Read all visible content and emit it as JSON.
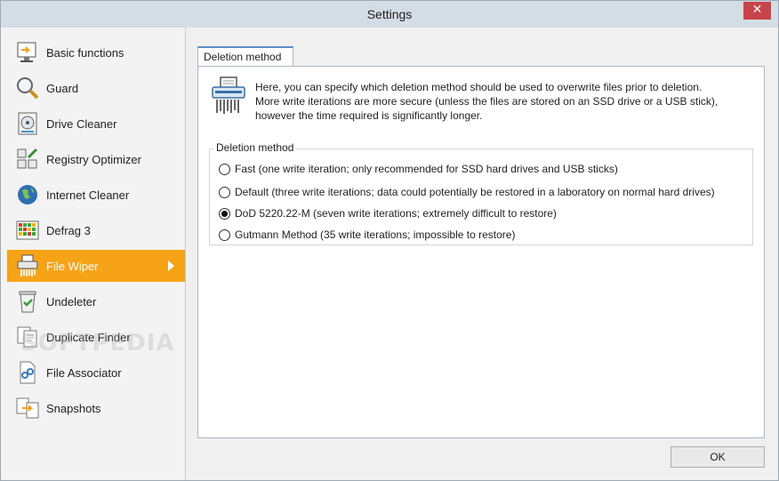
{
  "window": {
    "title": "Settings",
    "close_glyph": "✕"
  },
  "sidebar": {
    "items": [
      {
        "label": "Basic functions",
        "icon": "basic-functions-icon"
      },
      {
        "label": "Guard",
        "icon": "magnifier-icon"
      },
      {
        "label": "Drive Cleaner",
        "icon": "drive-icon"
      },
      {
        "label": "Registry Optimizer",
        "icon": "registry-icon"
      },
      {
        "label": "Internet Cleaner",
        "icon": "globe-icon"
      },
      {
        "label": "Defrag 3",
        "icon": "defrag-icon"
      },
      {
        "label": "File Wiper",
        "icon": "shredder-icon",
        "active": true
      },
      {
        "label": "Undeleter",
        "icon": "recycle-bin-icon"
      },
      {
        "label": "Duplicate Finder",
        "icon": "duplicate-icon"
      },
      {
        "label": "File Associator",
        "icon": "file-link-icon"
      },
      {
        "label": "Snapshots",
        "icon": "snapshot-icon"
      }
    ],
    "active_color": "#f6a318"
  },
  "watermark": "SOFTPEDIA",
  "tab": {
    "label": "Deletion method"
  },
  "description": {
    "line1": "Here, you can specify which deletion method should be used to overwrite files prior to deletion.",
    "line2": "More write iterations are more secure (unless the files are stored on an SSD drive or a USB stick),",
    "line3": "however the time required is significantly longer."
  },
  "deletion_group": {
    "label": "Deletion method",
    "options": [
      {
        "label": "Fast (one write iteration; only recommended for SSD hard drives and USB sticks)",
        "checked": false
      },
      {
        "label": "Default (three write iterations; data could potentially be restored in a laboratory on normal hard drives)",
        "checked": false
      },
      {
        "label": "DoD 5220.22-M (seven write iterations; extremely difficult to restore)",
        "checked": true
      },
      {
        "label": "Gutmann Method (35 write iterations; impossible to restore)",
        "checked": false
      }
    ]
  },
  "footer": {
    "ok_label": "OK"
  }
}
